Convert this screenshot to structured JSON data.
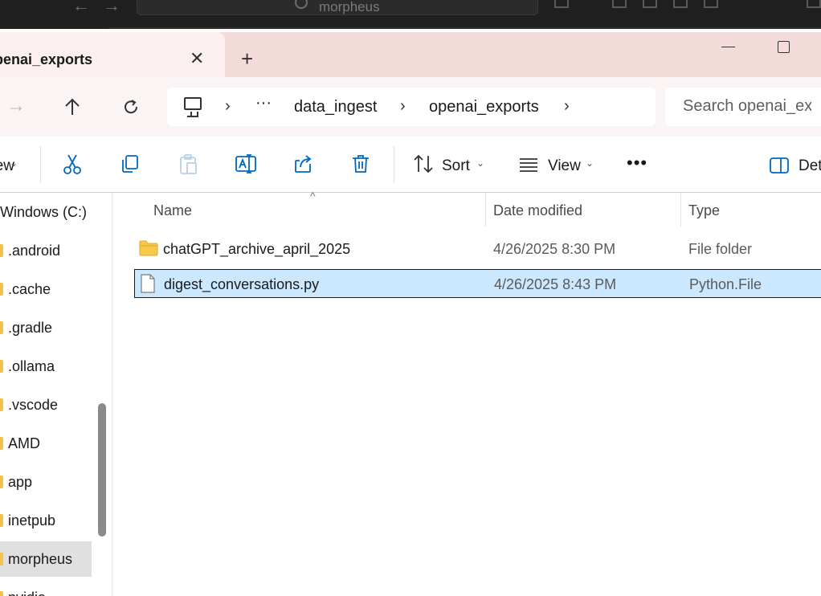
{
  "background_window": {
    "search_text": "morpheus"
  },
  "tab": {
    "title": "openai_exports",
    "close_glyph": "✕",
    "new_tab_glyph": "+"
  },
  "breadcrumb": {
    "more_glyph": "···",
    "items": [
      "data_ingest",
      "openai_exports"
    ]
  },
  "search": {
    "placeholder": "Search openai_exports"
  },
  "toolbar": {
    "new_label": "New",
    "sort_label": "Sort",
    "view_label": "View",
    "more_glyph": "•••",
    "details_label": "Details"
  },
  "sidebar": {
    "drive_label": "Windows (C:)",
    "items": [
      ".android",
      ".cache",
      ".gradle",
      ".ollama",
      ".vscode",
      "AMD",
      "app",
      "inetpub",
      "morpheus",
      "nvidia"
    ],
    "selected_item": "morpheus"
  },
  "columns": {
    "name": "Name",
    "date": "Date modified",
    "type": "Type"
  },
  "files": [
    {
      "name": "chatGPT_archive_april_2025",
      "date": "4/26/2025 8:30 PM",
      "type": "File folder",
      "icon": "folder-icon"
    },
    {
      "name": "digest_conversations.py",
      "date": "4/26/2025 8:43 PM",
      "type": "Python.File",
      "icon": "file-icon"
    }
  ],
  "colors": {
    "accent": "#0067c0",
    "selection": "#cce8ff",
    "folder": "#f2c24b",
    "titlebar": "#f3dbd9"
  }
}
